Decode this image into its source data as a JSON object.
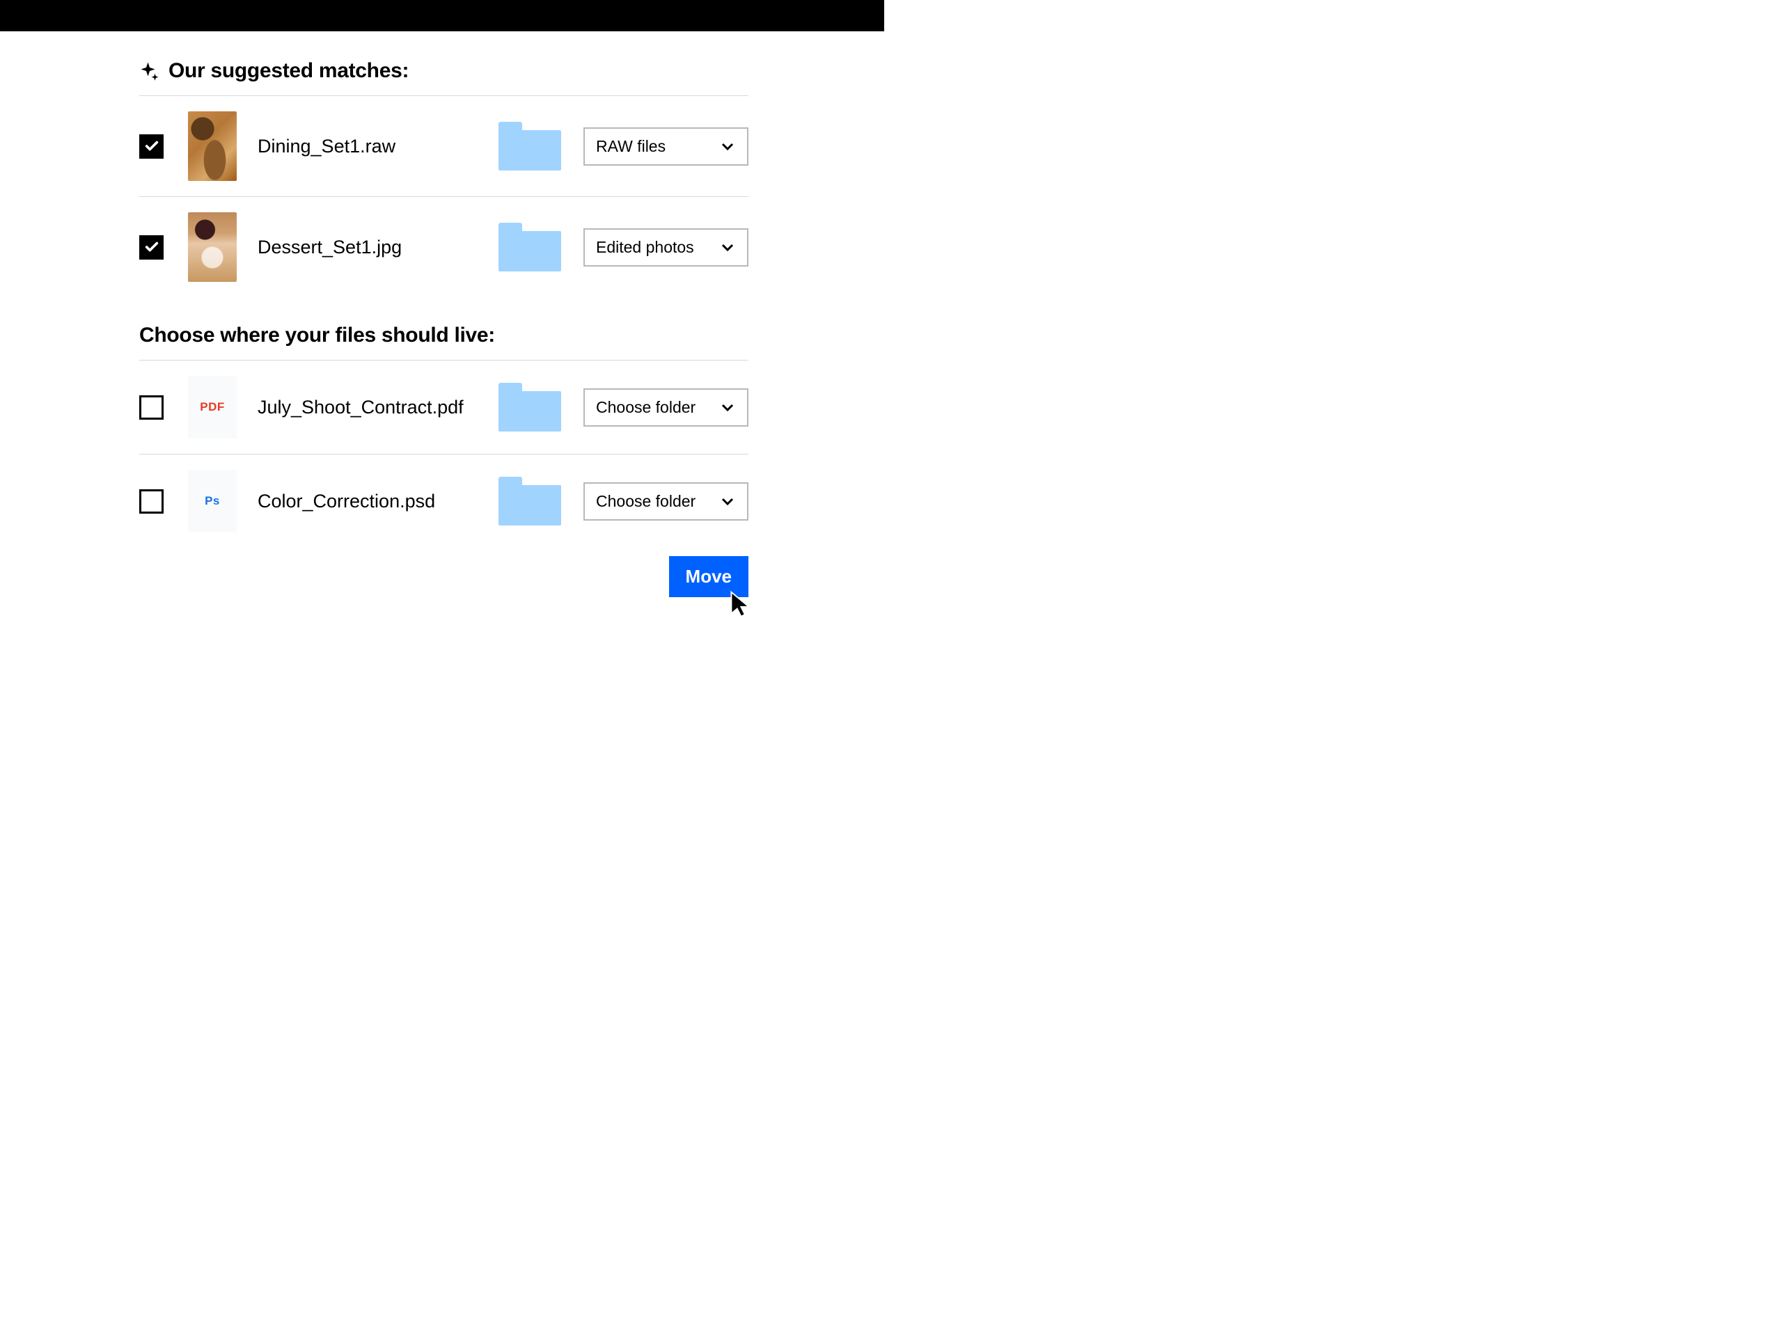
{
  "suggested": {
    "title": "Our suggested matches:",
    "items": [
      {
        "filename": "Dining_Set1.raw",
        "folder": "RAW files",
        "checked": true,
        "thumb": "dining"
      },
      {
        "filename": "Dessert_Set1.jpg",
        "folder": "Edited photos",
        "checked": true,
        "thumb": "dessert"
      }
    ]
  },
  "choose": {
    "title": "Choose where your files should live:",
    "items": [
      {
        "filename": "July_Shoot_Contract.pdf",
        "folder": "Choose folder",
        "checked": false,
        "icon": "PDF"
      },
      {
        "filename": "Color_Correction.psd",
        "folder": "Choose folder",
        "checked": false,
        "icon": "Ps"
      }
    ]
  },
  "actions": {
    "move_label": "Move"
  }
}
